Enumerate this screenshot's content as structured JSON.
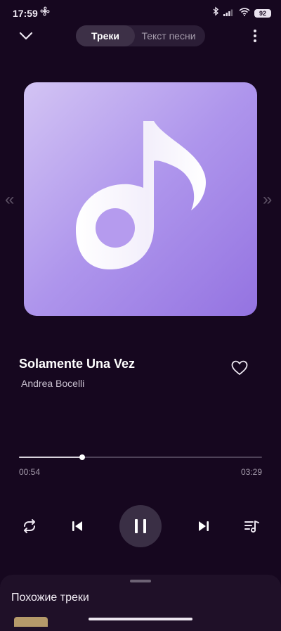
{
  "status_bar": {
    "time": "17:59",
    "battery": "92",
    "icons": [
      "fan-icon",
      "bluetooth-icon",
      "signal-icon",
      "wifi-icon",
      "battery-icon"
    ]
  },
  "header": {
    "tabs": [
      {
        "label": "Треки",
        "active": true
      },
      {
        "label": "Текст песни",
        "active": false
      }
    ]
  },
  "track": {
    "title": "Solamente Una Vez",
    "artist": "Andrea Bocelli",
    "elapsed": "00:54",
    "duration": "03:29",
    "progress": 0.26,
    "liked": false
  },
  "controls": [
    "repeat-icon",
    "previous-icon",
    "pause-icon",
    "next-icon",
    "playlist-icon"
  ],
  "bottom_sheet": {
    "title": "Похожие треки"
  },
  "colors": {
    "background": "#16071f",
    "cover_light": "#d3c4f4",
    "cover_dark": "#9473e1"
  }
}
